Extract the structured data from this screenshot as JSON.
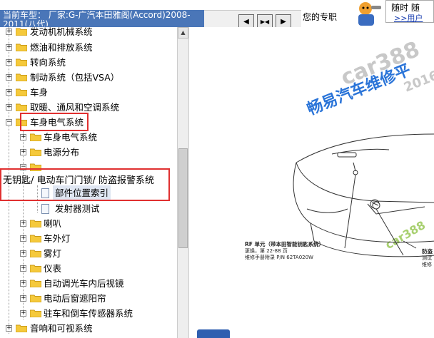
{
  "header": {
    "vehicle_label": "当前车型：",
    "vehicle_name": "厂家:G-广汽本田雅阁(Accord)2008-2011(八代)",
    "pro_text": "您的专职",
    "help_line1": "随时 随",
    "help_line2": ">>用户"
  },
  "toolbar": {
    "btn_prev": "◀",
    "btn_split": "▶◀",
    "btn_next": "▶"
  },
  "tree": {
    "items": [
      {
        "label": "发动机机械系统"
      },
      {
        "label": "燃油和排放系统"
      },
      {
        "label": "转向系统"
      },
      {
        "label": "制动系统（包括VSA）"
      },
      {
        "label": "车身"
      },
      {
        "label": "取暖、通风和空调系统"
      },
      {
        "label": "车身电气系统"
      },
      {
        "label": "车身电气系统"
      },
      {
        "label": "电源分布"
      },
      {
        "label": "部件位置索引"
      },
      {
        "label": "发射器测试"
      },
      {
        "label": "喇叭"
      },
      {
        "label": "车外灯"
      },
      {
        "label": "雾灯"
      },
      {
        "label": "仪表"
      },
      {
        "label": "自动调光车内后视镜"
      },
      {
        "label": "电动后窗遮阳帘"
      },
      {
        "label": "驻车和倒车传感器系统"
      },
      {
        "label": "音响和可视系统"
      }
    ],
    "overlay_label": "无钥匙/ 电动车门门锁/ 防盗报警系统"
  },
  "content": {
    "watermark_1": "car388",
    "watermark_2": "畅易汽车维修平",
    "watermark_3": "2016",
    "watermark_4": "car388",
    "caption_title": "RF 单元（带本田智能钥匙系统）",
    "caption_line2": "更换，第 22-88 页",
    "caption_line3": "维修手册附录 P/N 62TA020W",
    "caption_right1": "防盗",
    "caption_right2": "测试",
    "caption_right3": "维修"
  },
  "colors": {
    "accent_blue": "#4a76b8",
    "highlight_red": "#e03030",
    "folder_yellow": "#f5c93b"
  }
}
